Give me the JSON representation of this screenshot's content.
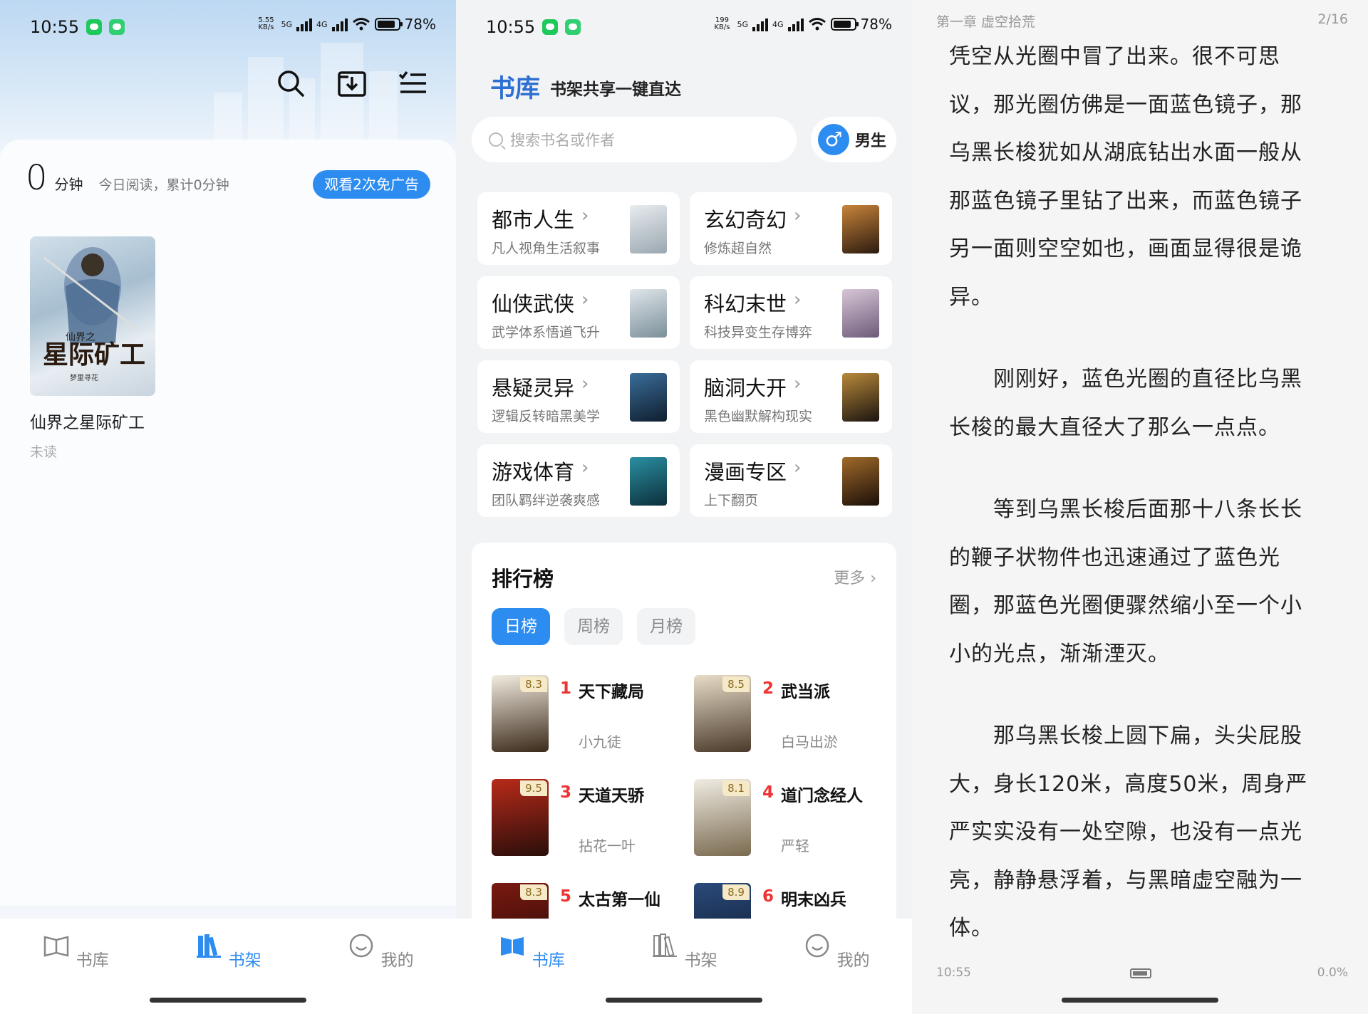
{
  "status": {
    "time": "10:55",
    "battery": "78%",
    "net_speed_1": "5.55\nKB/s",
    "net_speed_2": "199\nKB/s",
    "signal_1": "5G",
    "signal_2": "4G"
  },
  "bookshelf": {
    "minutes": "0",
    "minutes_unit": "分钟",
    "today_summary": "今日阅读，累计0分钟",
    "ad_button": "观看2次免广告",
    "books": [
      {
        "title": "仙界之星际矿工",
        "status": "未读",
        "cover_text": "星际矿工",
        "cover_small": "仙界之",
        "cover_author": "梦里寻花"
      }
    ]
  },
  "nav": {
    "library": "书库",
    "shelf": "书架",
    "mine": "我的"
  },
  "library": {
    "title": "书库",
    "subtitle": "书架共享一键直达",
    "search_placeholder": "搜索书名或作者",
    "gender": "男生",
    "categories": [
      {
        "name": "都市人生",
        "desc": "凡人视角生活叙事"
      },
      {
        "name": "玄幻奇幻",
        "desc": "修炼超自然"
      },
      {
        "name": "仙侠武侠",
        "desc": "武学体系悟道飞升"
      },
      {
        "name": "科幻末世",
        "desc": "科技异变生存博弈"
      },
      {
        "name": "悬疑灵异",
        "desc": "逻辑反转暗黑美学"
      },
      {
        "name": "脑洞大开",
        "desc": "黑色幽默解构现实"
      },
      {
        "name": "游戏体育",
        "desc": "团队羁绊逆袭爽感"
      },
      {
        "name": "漫画专区",
        "desc": "上下翻页"
      }
    ],
    "ranking": {
      "title": "排行榜",
      "more": "更多",
      "tabs": [
        "日榜",
        "周榜",
        "月榜"
      ],
      "active_tab": "日榜",
      "items": [
        {
          "rank": "1",
          "title": "天下藏局",
          "author": "小九徒",
          "score": "8.3"
        },
        {
          "rank": "2",
          "title": "武当派",
          "author": "白马出淤",
          "score": "8.5"
        },
        {
          "rank": "3",
          "title": "天道天骄",
          "author": "拈花一叶",
          "score": "9.5"
        },
        {
          "rank": "4",
          "title": "道门念经人",
          "author": "严轻",
          "score": "8.1"
        },
        {
          "rank": "5",
          "title": "太古第一仙",
          "author": "",
          "score": "8.3"
        },
        {
          "rank": "6",
          "title": "明末凶兵",
          "author": "",
          "score": "8.9"
        }
      ]
    }
  },
  "reader": {
    "chapter": "第一章 虚空拾荒",
    "page": "2/16",
    "time": "10:55",
    "progress": "0.0%",
    "paragraphs": [
      "凭空从光圈中冒了出来。很不可思议，那光圈仿佛是一面蓝色镜子，那乌黑长梭犹如从湖底钻出水面一般从那蓝色镜子里钻了出来，而蓝色镜子另一面则空空如也，画面显得很是诡异。",
      "　　刚刚好，蓝色光圈的直径比乌黑长梭的最大直径大了那么一点点。",
      "　　等到乌黑长梭后面那十八条长长的鞭子状物件也迅速通过了蓝色光圈，那蓝色光圈便骤然缩小至一个小小的光点，渐渐湮灭。",
      "　　那乌黑长梭上圆下扁，头尖屁股大，身长120米，高度50米，周身严严实实没有一处空隙，也没有一点光亮，静静悬浮着，与黑暗虚空融为一体。"
    ]
  },
  "colors": {
    "accent": "#2d8cf0",
    "rank_red": "#e33333",
    "title_blue": "#2d6fd2"
  }
}
